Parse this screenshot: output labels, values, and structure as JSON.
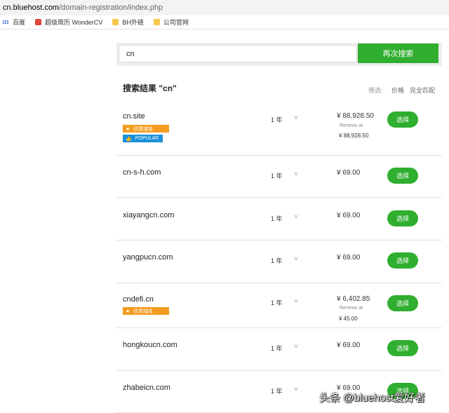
{
  "browser": {
    "url_host": "cn.bluehost.com",
    "url_path": "/domain-registration/index.php",
    "bookmarks": [
      "百度",
      "超级简历 WonderCV",
      "BH外链",
      "公司官网"
    ]
  },
  "search": {
    "value": "cn",
    "button_label": "再次搜索"
  },
  "results": {
    "title": "搜索结果 \"cn\"",
    "filter_label": "筛选:",
    "sort_price": "价格",
    "sort_exact": "完全匹配"
  },
  "rows": [
    {
      "domain": "cn.site",
      "period": "1 年",
      "price": "¥ 88,928.50",
      "renews_label": "Renews at",
      "renews_price": "¥ 88,928.50",
      "premium": "优质域名",
      "popular": "POPULAR",
      "select": "选择"
    },
    {
      "domain": "cn-s-h.com",
      "period": "1 年",
      "price": "¥ 69.00",
      "select": "选择"
    },
    {
      "domain": "xiayangcn.com",
      "period": "1 年",
      "price": "¥ 69.00",
      "select": "选择"
    },
    {
      "domain": "yangpucn.com",
      "period": "1 年",
      "price": "¥ 69.00",
      "select": "选择"
    },
    {
      "domain": "cndefi.cn",
      "period": "1 年",
      "price": "¥ 6,402.85",
      "renews_label": "Renews at",
      "renews_price": "¥ 45.00",
      "premium": "优质域名",
      "select": "选择"
    },
    {
      "domain": "hongkoucn.com",
      "period": "1 年",
      "price": "¥ 69.00",
      "select": "选择"
    },
    {
      "domain": "zhabeicn.com",
      "period": "1 年",
      "price": "¥ 69.00",
      "select": "选择"
    }
  ],
  "watermark": "头条 @bluehost爱好者",
  "colors": {
    "accent_green": "#2fae2f",
    "premium_orange": "#f39c1f",
    "popular_blue": "#1a90d9"
  }
}
